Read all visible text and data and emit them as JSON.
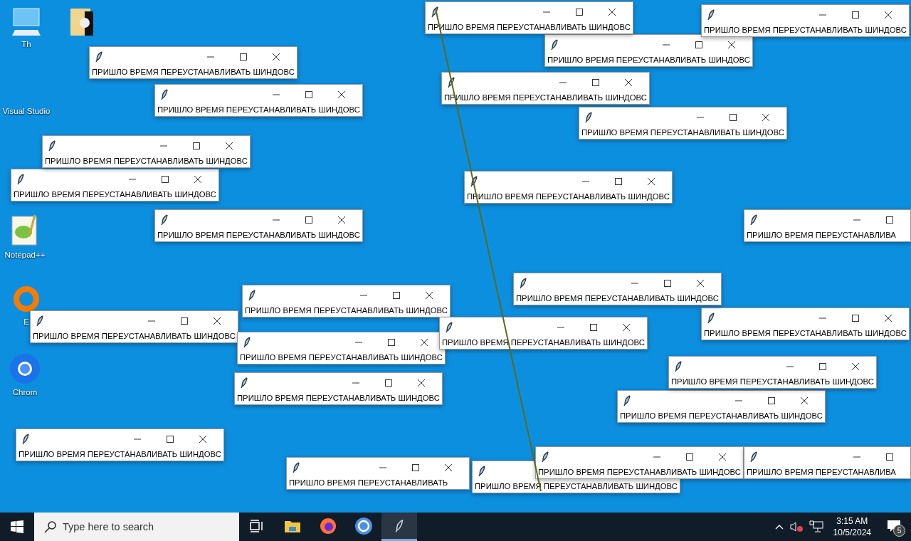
{
  "desktop_icons": [
    {
      "kind": "computer",
      "label": "Th"
    },
    {
      "kind": "folder"
    },
    {
      "kind": "none",
      "label": "Visual Studio"
    },
    {
      "kind": "notepad",
      "label": "Notepad++"
    },
    {
      "kind": "ring",
      "label": "E"
    },
    {
      "kind": "browser",
      "label": "Chrom"
    }
  ],
  "windows": [
    {
      "message": "ПРИШЛО ВРЕМЯ ПЕРЕУСТАНАВЛИВАТЬ ШИНДОВС"
    },
    {
      "message": "ПРИШЛО ВРЕМЯ ПЕРЕУСТАНАВЛИВАТЬ ШИНДОВС"
    },
    {
      "message": "ПРИШЛО ВРЕМЯ ПЕРЕУСТАНАВЛИВАТЬ ШИНДОВС"
    },
    {
      "message": "ПРИШЛО ВРЕМЯ ПЕРЕУСТАНАВЛИВАТЬ ШИНДОВС"
    },
    {
      "message": "ПРИШЛО ВРЕМЯ ПЕРЕУСТАНАВЛИВАТЬ ШИНДОВС"
    },
    {
      "message": "ПРИШЛО ВРЕМЯ ПЕРЕУСТАНАВЛИВАТЬ ШИНДОВС"
    },
    {
      "message": "ПРИШЛО ВРЕМЯ ПЕРЕУСТАНАВЛИВАТЬ ШИНДОВС"
    },
    {
      "message": "ПРИШЛО ВРЕМЯ ПЕРЕУСТАНАВЛИВАТЬ ШИНДОВС"
    },
    {
      "message": "ПРИШЛО ВРЕМЯ ПЕРЕУСТАНАВЛИВАТЬ ШИНДОВС"
    },
    {
      "message": "ПРИШЛО ВРЕМЯ ПЕРЕУСТАНАВЛИВАТЬ ШИНДОВС"
    },
    {
      "message": "ПРИШЛО ВРЕМЯ ПЕРЕУСТАНАВЛИВАТЬ ШИНДОВС"
    },
    {
      "message": "ПРИШЛО ВРЕМЯ ПЕРЕУСТАНАВЛИВА"
    },
    {
      "message": "ПРИШЛО ВРЕМЯ ПЕРЕУСТАНАВЛИВАТЬ ШИНДОВС"
    },
    {
      "message": "ПРИШЛО ВРЕМЯ ПЕРЕУСТАНАВЛИВАТЬ ШИНДОВС"
    },
    {
      "message": "ПРИШЛО ВРЕМЯ ПЕРЕУСТАНАВЛИВАТЬ ШИНДОВС"
    },
    {
      "message": "ПРИШЛО ВРЕМЯ ПЕРЕУСТАНАВЛИВАТЬ ШИНДОВС"
    },
    {
      "message": "ПРИШЛО ВРЕМЯ ПЕРЕУСТАНАВЛИВАТЬ ШИНДОВС"
    },
    {
      "message": "ПРИШЛО ВРЕМЯ ПЕРЕУСТАНАВЛИВАТЬ ШИНДОВС"
    },
    {
      "message": "ПРИШЛО ВРЕМЯ ПЕРЕУСТАНАВЛИВАТЬ ШИНДОВС"
    },
    {
      "message": "ПРИШЛО ВРЕМЯ ПЕРЕУСТАНАВЛИВАТЬ ШИНДОВС"
    },
    {
      "message": "ПРИШЛО ВРЕМЯ ПЕРЕУСТАНАВЛИВАТЬ ШИНДОВС"
    },
    {
      "message": "ПРИШЛО ВРЕМЯ ПЕРЕУСТАНАВЛИВАТЬ ШИНДОВС"
    },
    {
      "message": "ПРИШЛО ВРЕМЯ ПЕРЕУСТАНАВЛИВАТЬ"
    },
    {
      "message": "ПРИШЛО ВРЕМЯ ПЕРЕУСТАНАВЛИВАТЬ ШИНДОВС"
    },
    {
      "message": "ПРИШЛО ВРЕМЯ ПЕРЕУСТАНАВЛИВАТЬ ШИНДОВС"
    },
    {
      "message": "ПРИШЛО ВРЕМЯ ПЕРЕУСТАНАВЛИВА"
    }
  ],
  "taskbar": {
    "search": {
      "placeholder": "Type here to search"
    },
    "apps": [
      {
        "kind": "task-view",
        "active": false
      },
      {
        "kind": "explorer",
        "active": false
      },
      {
        "kind": "firefox",
        "active": false
      },
      {
        "kind": "browser",
        "active": false
      },
      {
        "kind": "feather",
        "active": true
      }
    ],
    "tray": {
      "muted": true,
      "time": "3:15 AM",
      "date": "10/5/2024",
      "notifications": "5"
    }
  }
}
